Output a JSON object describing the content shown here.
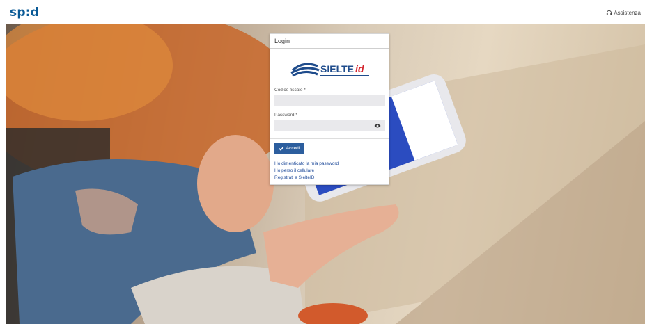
{
  "header": {
    "logo_text": "sp:d",
    "assistance_label": "Assistenza"
  },
  "login": {
    "title": "Login",
    "brand_name": "SIELTE",
    "brand_suffix": "id",
    "fiscal_code_label": "Codice fiscale *",
    "fiscal_code_value": "",
    "password_label": "Password *",
    "password_value": "",
    "submit_label": "Accedi",
    "links": {
      "forgot_password": "Ho dimenticato la mia password",
      "lost_phone": "Ho perso il cellulare",
      "register": "Registrati a SielteID"
    }
  },
  "colors": {
    "spid_blue": "#0a5a96",
    "button_blue": "#2c5e9e",
    "link_blue": "#1f4b9a",
    "field_bg": "#e9e9ec",
    "brand_red": "#d4252e"
  },
  "icons": {
    "assistance": "headset-icon",
    "show_password": "eye-icon",
    "submit": "check-icon"
  }
}
